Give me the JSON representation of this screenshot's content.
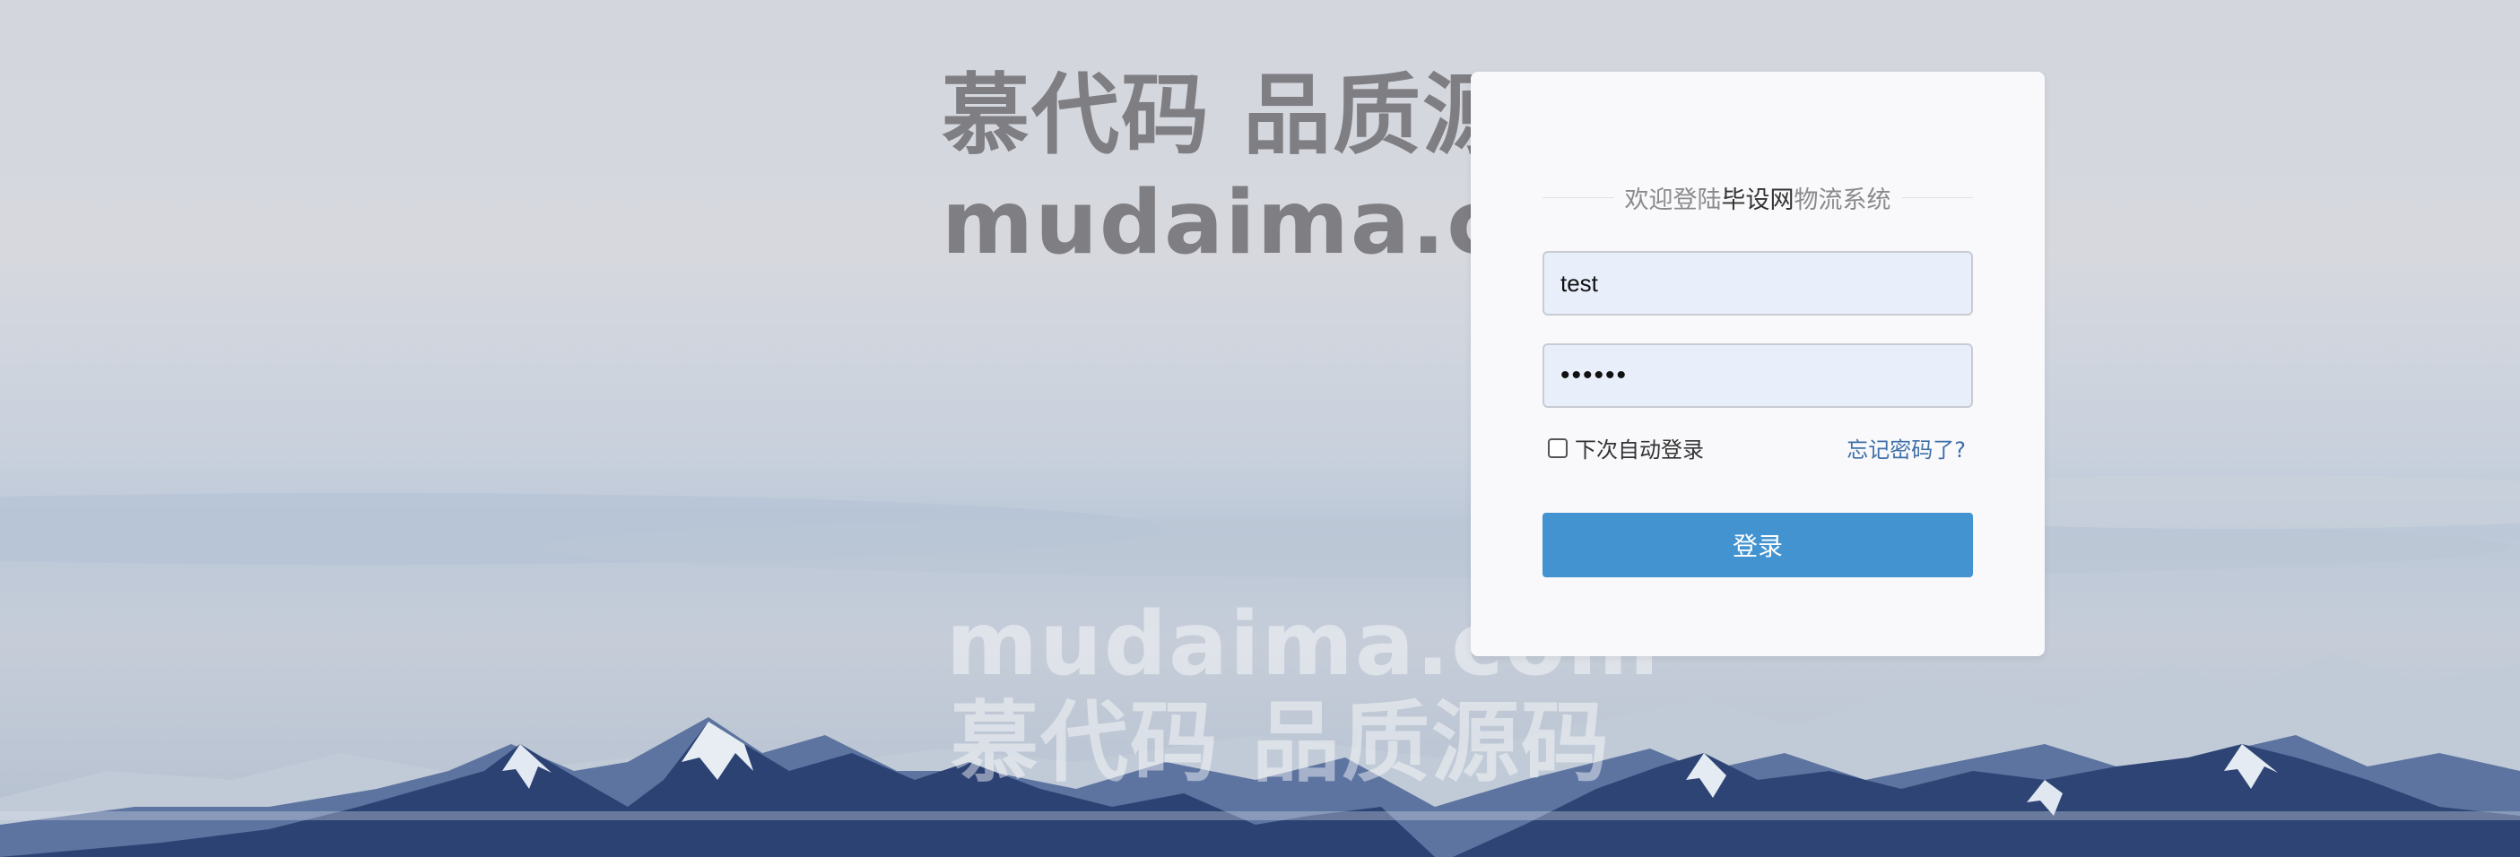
{
  "watermark": {
    "top_cn": "慕代码 品质源码",
    "top_en": "mudaima.com",
    "bottom_en": "mudaima.com",
    "bottom_cn": "慕代码 品质源码"
  },
  "login": {
    "title_prefix": "欢迎登陆",
    "title_highlight": "毕设网",
    "title_suffix": "物流系统",
    "username_value": "test",
    "password_value": "••••••",
    "remember_label": "下次自动登录",
    "remember_checked": false,
    "forgot_link": "忘记密码了?",
    "submit_label": "登录"
  },
  "colors": {
    "button": "#4393d1",
    "link": "#3f6fa8",
    "input_bg": "#e8eefa"
  }
}
